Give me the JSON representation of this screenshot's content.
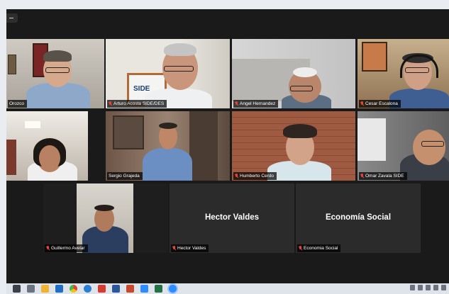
{
  "tiles": [
    {
      "name": "Orozco"
    },
    {
      "name": "Arturo Acosta SIDE/DES"
    },
    {
      "name": "Angel Hernandez"
    },
    {
      "name": "Cesar Escalona"
    },
    {
      "name": ""
    },
    {
      "name": "Sergio Grajeda"
    },
    {
      "name": "Humberto Cerdo"
    },
    {
      "name": "Omar Zavala SIDE"
    },
    {
      "name": "Guillermo Avelar"
    },
    {
      "name": "Hector Valdes",
      "display": "Hector Valdes"
    },
    {
      "name": "Economia Social",
      "display": "Economía Social"
    }
  ],
  "background_signage": {
    "side_sign": "SIDE"
  },
  "colors": {
    "active_speaker_border": "#b8d458",
    "muted_icon": "#e0443e",
    "meeting_bg": "#1a1a1a"
  },
  "taskbar": {
    "icons": [
      "windows-start",
      "task-view",
      "file-explorer",
      "outlook",
      "chrome",
      "edge",
      "acrobat",
      "word",
      "powerpoint",
      "zoom",
      "excel",
      "zoom-meeting"
    ]
  }
}
